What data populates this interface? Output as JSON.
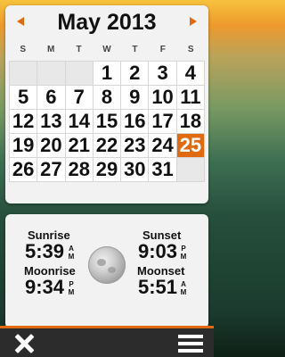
{
  "calendar": {
    "month_title": "May 2013",
    "weekdays": [
      "S",
      "M",
      "T",
      "W",
      "T",
      "F",
      "S"
    ],
    "weeks": [
      [
        "",
        "",
        "",
        "1",
        "2",
        "3",
        "4"
      ],
      [
        "5",
        "6",
        "7",
        "8",
        "9",
        "10",
        "11"
      ],
      [
        "12",
        "13",
        "14",
        "15",
        "16",
        "17",
        "18"
      ],
      [
        "19",
        "20",
        "21",
        "22",
        "23",
        "24",
        "25"
      ],
      [
        "26",
        "27",
        "28",
        "29",
        "30",
        "31",
        ""
      ]
    ],
    "today": "25",
    "accent_color": "#e06a10"
  },
  "sun_moon": {
    "sunrise_label": "Sunrise",
    "sunrise_time": "5:39",
    "sunrise_ampm": [
      "A",
      "M"
    ],
    "sunset_label": "Sunset",
    "sunset_time": "9:03",
    "sunset_ampm": [
      "P",
      "M"
    ],
    "moonrise_label": "Moonrise",
    "moonrise_time": "9:34",
    "moonrise_ampm": [
      "P",
      "M"
    ],
    "moonset_label": "Moonset",
    "moonset_time": "5:51",
    "moonset_ampm": [
      "A",
      "M"
    ],
    "moon_phase_icon": "moon-phase-icon"
  },
  "toolbar": {
    "close_icon": "close-icon",
    "menu_icon": "menu-icon"
  }
}
